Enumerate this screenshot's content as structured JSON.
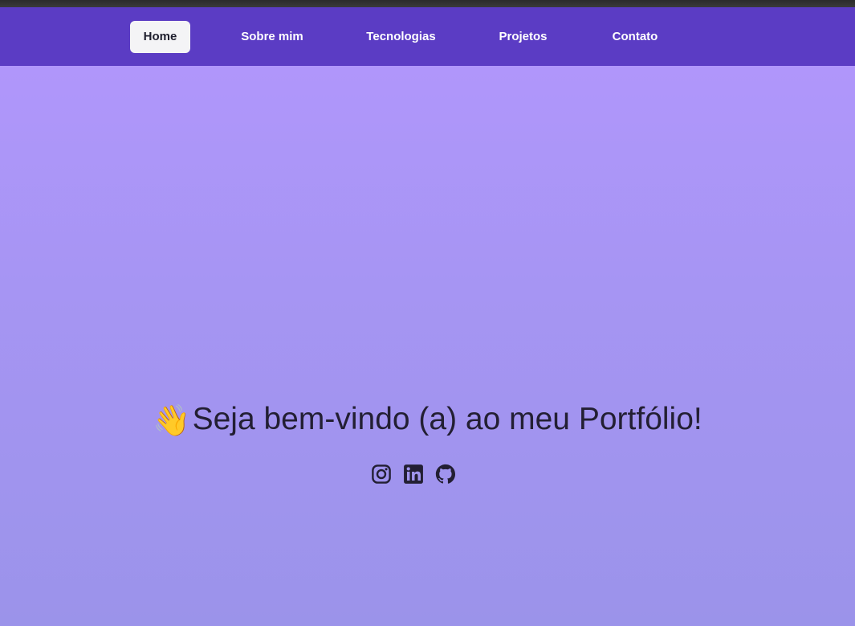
{
  "nav": {
    "items": [
      {
        "label": "Home",
        "active": true
      },
      {
        "label": "Sobre mim",
        "active": false
      },
      {
        "label": "Tecnologias",
        "active": false
      },
      {
        "label": "Projetos",
        "active": false
      },
      {
        "label": "Contato",
        "active": false
      }
    ]
  },
  "hero": {
    "wave_emoji": "👋",
    "greeting": "Seja bem-vindo (a) ao meu Portfólio!"
  },
  "socials": [
    {
      "icon": "instagram-icon"
    },
    {
      "icon": "linkedin-icon"
    },
    {
      "icon": "github-icon"
    }
  ],
  "colors": {
    "navbar": "#5b3cc4",
    "hero_top": "#b096fb",
    "hero_bottom": "#9b93ea",
    "text_dark": "#231f33",
    "active_tab_bg": "#f4f4f6"
  }
}
